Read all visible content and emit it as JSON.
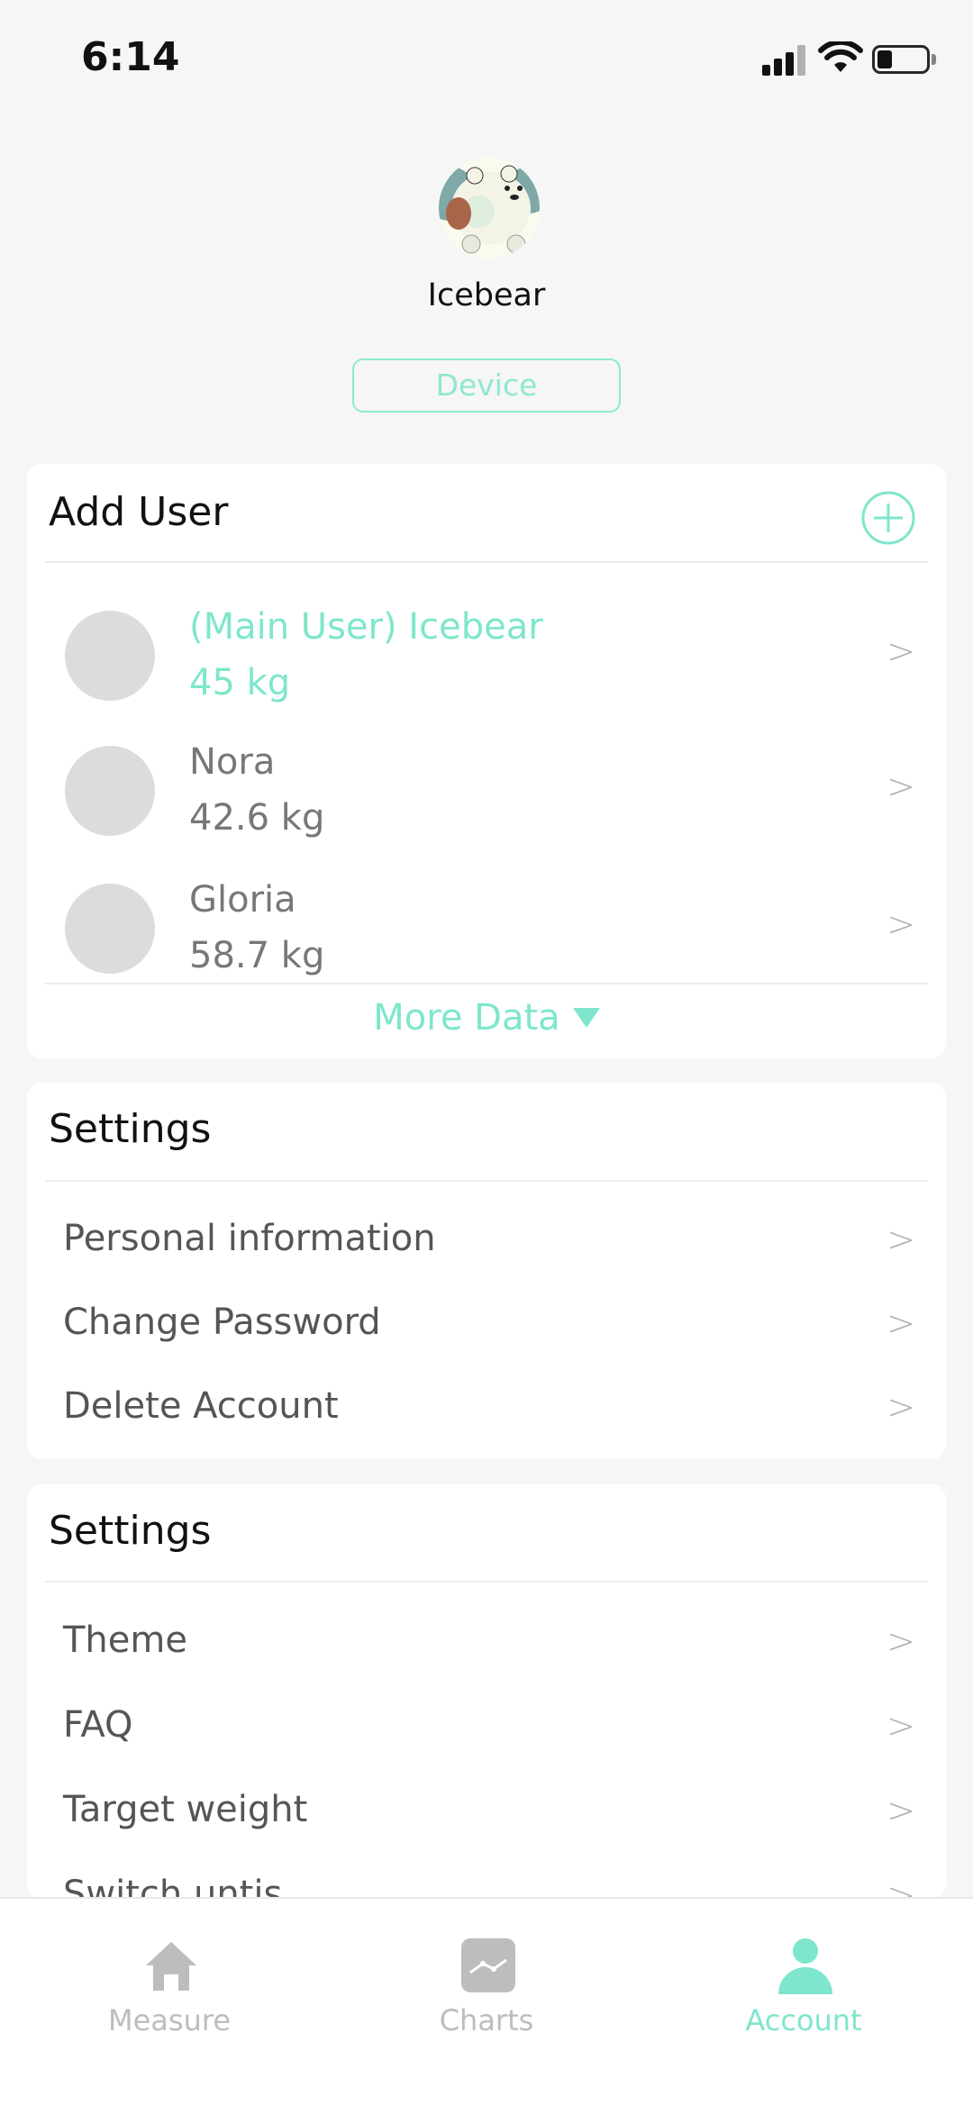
{
  "status": {
    "time": "6:14"
  },
  "profile": {
    "name": "Icebear",
    "device_label": "Device"
  },
  "users_card": {
    "title": "Add User",
    "users": [
      {
        "name": "(Main User) Icebear",
        "weight": "45 kg"
      },
      {
        "name": "Nora",
        "weight": "42.6 kg"
      },
      {
        "name": "Gloria",
        "weight": "58.7 kg"
      }
    ],
    "more_label": "More Data"
  },
  "account_settings": {
    "title": "Settings",
    "items": [
      {
        "label": "Personal information"
      },
      {
        "label": "Change Password"
      },
      {
        "label": "Delete Account"
      }
    ]
  },
  "app_settings": {
    "title": "Settings",
    "items": [
      {
        "label": "Theme"
      },
      {
        "label": "FAQ"
      },
      {
        "label": "Target weight"
      },
      {
        "label": "Switch untis"
      }
    ]
  },
  "chevron": ">",
  "tabs": [
    {
      "label": "Measure",
      "icon": "home-icon"
    },
    {
      "label": "Charts",
      "icon": "chart-icon"
    },
    {
      "label": "Account",
      "icon": "person-icon"
    }
  ],
  "active_tab": "Account",
  "colors": {
    "accent": "#7ee6cc",
    "inactive": "#bdbdbd",
    "background": "#f6f6f6"
  }
}
